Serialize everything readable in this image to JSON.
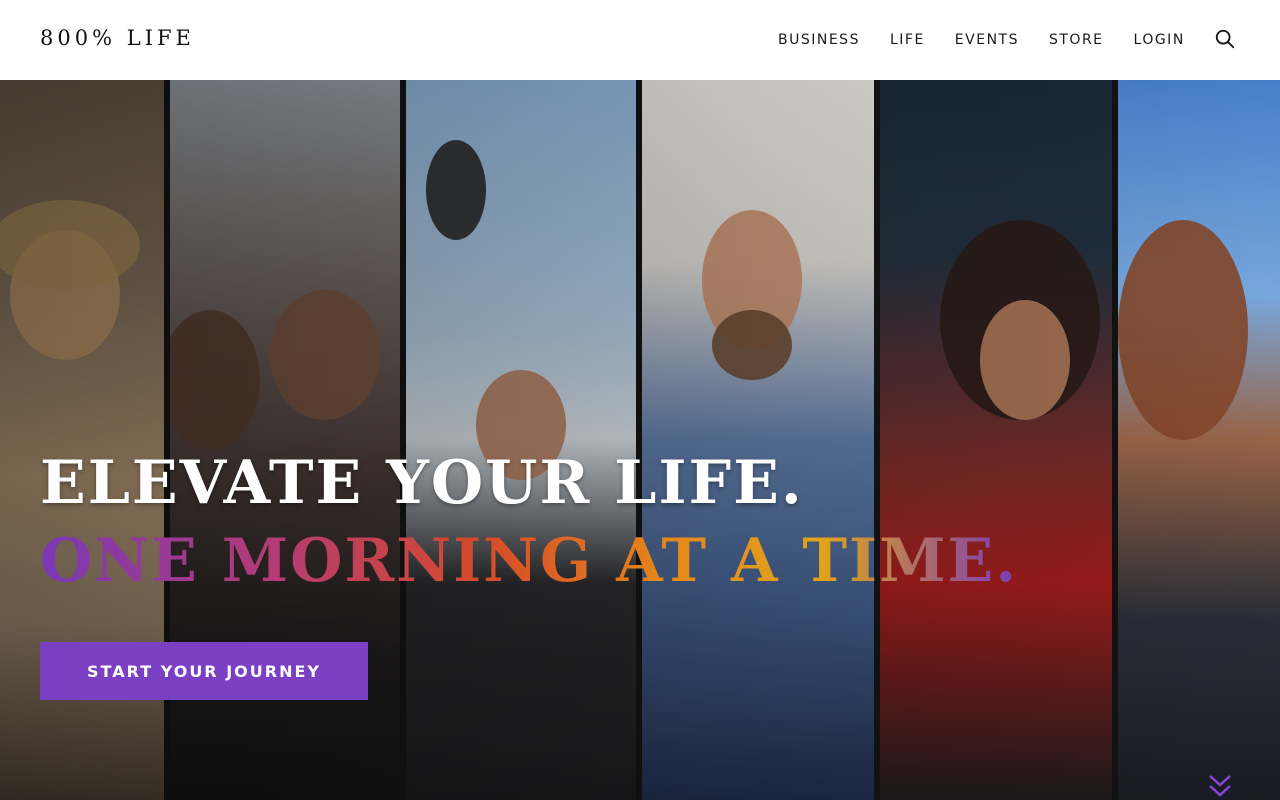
{
  "header": {
    "logo": "800% LIFE",
    "nav": [
      "BUSINESS",
      "LIFE",
      "EVENTS",
      "STORE",
      "LOGIN"
    ]
  },
  "hero": {
    "headline": "ELEVATE YOUR LIFE.",
    "subheadline": "ONE MORNING AT A TIME.",
    "cta_label": "START YOUR JOURNEY"
  },
  "icons": {
    "search": "search-icon",
    "scroll": "chevron-down-icon"
  },
  "colors": {
    "accent": "#7b3fc4",
    "header_bg": "#ffffff",
    "gradient_start": "#7a39b8",
    "gradient_mid": "#d64a2a",
    "gradient_end": "#e0a41a"
  }
}
